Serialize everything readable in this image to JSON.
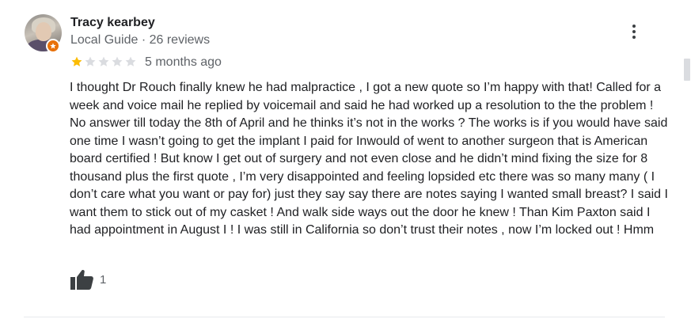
{
  "reviewer": {
    "name": "Tracy kearbey",
    "meta": "Local Guide · 26 reviews"
  },
  "rating": {
    "value": 1,
    "max": 5,
    "filled_color": "#fbbc04",
    "empty_color": "#dadce0"
  },
  "time": "5 months ago",
  "review_text": "I thought Dr Rouch finally knew he had malpractice , I got a new quote so I’m happy with that! Called for a week and voice mail he replied by voicemail and said he had worked up a resolution to the the problem ! No answer till today the 8th of April and he thinks  it’s not in the works ? The works is if you would have said one time I wasn’t going to get the implant I paid for Inwould of went to another surgeon that is American board certified ! But know I get out of surgery and not even close and he didn’t mind fixing the size for 8 thousand plus the first quote , I’m very disappointed and feeling lopsided etc there was so many many ( I don’t care what you want or pay for) just they say say there are notes saying I wanted small breast? I said I want them to stick out of my casket ! And walk side ways out the door he knew ! Than Kim Paxton said I had appointment in August I ! I was still in California so don’t trust their notes , now I’m locked out ! Hmm",
  "likes": {
    "count": "1",
    "icon": "thumbs-up-icon"
  },
  "icons": {
    "more": "more-vert-icon",
    "badge": "local-guide-badge-icon"
  },
  "colors": {
    "badge": "#e8710a",
    "text": "#202124",
    "muted": "#5f6368"
  }
}
